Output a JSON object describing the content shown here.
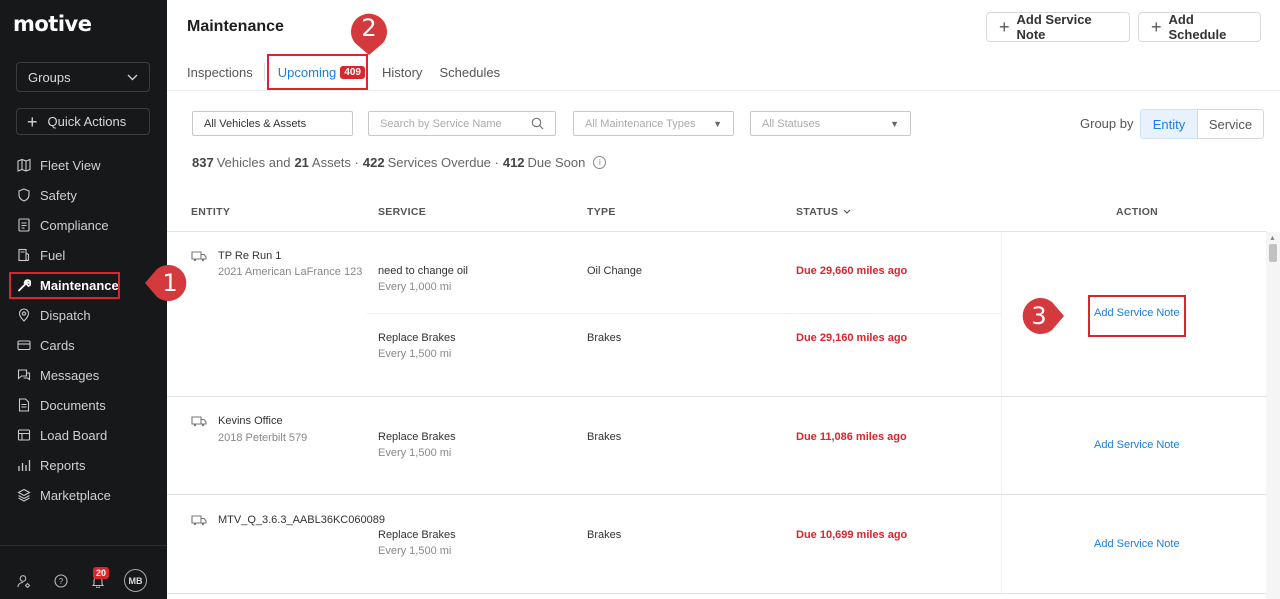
{
  "brand": {
    "logo": "motive"
  },
  "sidebar": {
    "groups_label": "Groups",
    "quick_actions_label": "Quick Actions",
    "items": [
      {
        "label": "Fleet View",
        "icon": "map-icon"
      },
      {
        "label": "Safety",
        "icon": "shield-icon"
      },
      {
        "label": "Compliance",
        "icon": "document-icon"
      },
      {
        "label": "Fuel",
        "icon": "fuel-icon"
      },
      {
        "label": "Maintenance",
        "icon": "wrench-icon"
      },
      {
        "label": "Dispatch",
        "icon": "location-icon"
      },
      {
        "label": "Cards",
        "icon": "card-icon"
      },
      {
        "label": "Messages",
        "icon": "chat-icon"
      },
      {
        "label": "Documents",
        "icon": "file-icon"
      },
      {
        "label": "Load Board",
        "icon": "truck-icon"
      },
      {
        "label": "Reports",
        "icon": "chart-icon"
      },
      {
        "label": "Marketplace",
        "icon": "layers-icon"
      }
    ],
    "active_item": "Maintenance",
    "notification_count": "20",
    "avatar_initials": "MB"
  },
  "header": {
    "title": "Maintenance",
    "add_service_note_label": "Add Service Note",
    "add_schedule_label": "Add Schedule",
    "tabs": [
      {
        "label": "Inspections"
      },
      {
        "label": "Upcoming",
        "badge": "409"
      },
      {
        "label": "History"
      },
      {
        "label": "Schedules"
      }
    ],
    "active_tab": "Upcoming"
  },
  "filters": {
    "vehicles_assets": "All Vehicles & Assets",
    "search_placeholder": "Search by Service Name",
    "maintenance_types": "All Maintenance Types",
    "statuses": "All Statuses",
    "group_by_label": "Group by",
    "group_by_options": [
      "Entity",
      "Service"
    ],
    "group_by_selected": "Entity"
  },
  "summary": {
    "vehicles_count": "837",
    "vehicles_text": "Vehicles and",
    "assets_count": "21",
    "assets_text": "Assets ·",
    "overdue_count": "422",
    "overdue_text": "Services Overdue ·",
    "due_soon_count": "412",
    "due_soon_text": "Due Soon"
  },
  "table": {
    "columns": {
      "entity": "ENTITY",
      "service": "SERVICE",
      "type": "TYPE",
      "status": "STATUS",
      "action": "ACTION"
    },
    "rows": [
      {
        "entity_name": "TP Re Run 1",
        "entity_desc": "2021 American LaFrance 123",
        "services": [
          {
            "name": "need to change oil",
            "interval": "Every 1,000 mi",
            "type": "Oil Change",
            "status": "Due 29,660 miles ago"
          },
          {
            "name": "Replace Brakes",
            "interval": "Every 1,500 mi",
            "type": "Brakes",
            "status": "Due 29,160 miles ago"
          }
        ],
        "action": "Add Service Note"
      },
      {
        "entity_name": "Kevins Office",
        "entity_desc": "2018 Peterbilt 579",
        "services": [
          {
            "name": "Replace Brakes",
            "interval": "Every 1,500 mi",
            "type": "Brakes",
            "status": "Due 11,086 miles ago"
          }
        ],
        "action": "Add Service Note"
      },
      {
        "entity_name": "MTV_Q_3.6.3_AABL36KC060089",
        "entity_desc": "",
        "services": [
          {
            "name": "Replace Brakes",
            "interval": "Every 1,500 mi",
            "type": "Brakes",
            "status": "Due 10,699 miles ago"
          }
        ],
        "action": "Add Service Note"
      }
    ]
  },
  "callouts": [
    "1",
    "2",
    "3"
  ],
  "colors": {
    "sidebar_bg": "#17181a",
    "accent_blue": "#1b7ee0",
    "alert_red": "#d9252c"
  }
}
